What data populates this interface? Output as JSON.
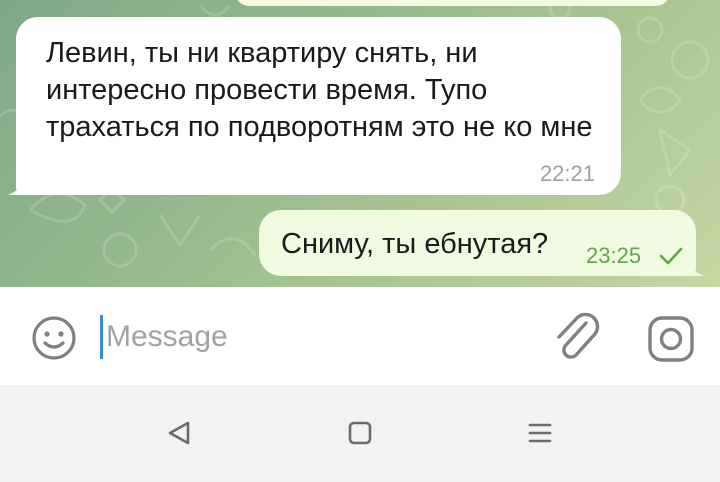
{
  "chat": {
    "incoming_message": {
      "text": "Левин, ты ни квартиру снять, ни интересно провести время. Тупо трахаться по подворотням это не ко мне",
      "time": "22:21"
    },
    "outgoing_message": {
      "text": "Сниму, ты ебнутая?",
      "time": "23:25",
      "status_icon": "check-icon"
    }
  },
  "composer": {
    "placeholder": "Message",
    "value": "",
    "emoji_icon": "smile-icon",
    "attach_icon": "paperclip-icon",
    "camera_icon": "camera-icon"
  },
  "navigation": {
    "back_icon": "back-triangle-icon",
    "home_icon": "home-square-icon",
    "menu_icon": "menu-lines-icon"
  },
  "colors": {
    "incoming_bubble": "#ffffff",
    "outgoing_bubble": "#f0fbe1",
    "outgoing_time": "#5fa64a",
    "caret": "#3f8ad8"
  }
}
